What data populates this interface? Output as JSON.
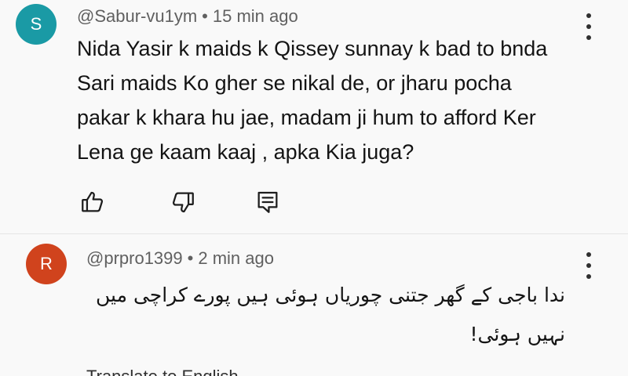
{
  "comments": [
    {
      "avatar_letter": "S",
      "avatar_color": "#1a9aa5",
      "username": "@Sabur-vu1ym",
      "separator": "•",
      "time": "15 min ago",
      "body_lines": [
        "Nida Yasir k maids k Qissey sunnay k bad to bnda",
        "Sari maids Ko gher se nikal de, or jharu pocha",
        "pakar k khara hu jae,  madam ji hum to afford Ker",
        "Lena ge kaam kaaj , apka Kia juga?"
      ],
      "actions": [
        "like-icon",
        "dislike-icon",
        "reply-icon"
      ]
    },
    {
      "avatar_letter": "R",
      "avatar_color": "#d0431d",
      "username": "@prpro1399",
      "separator": "•",
      "time": "2 min ago",
      "body_lines": [
        "ندا باجی کے گھر جتنی چوریاں ہوئی ہیں پورے کراچی میں",
        "نہیں ہوئی!"
      ],
      "translate_label": "Translate to English"
    }
  ],
  "colors": {
    "background": "#f9f9f9",
    "meta_text": "#606060",
    "body_text": "#141414"
  }
}
